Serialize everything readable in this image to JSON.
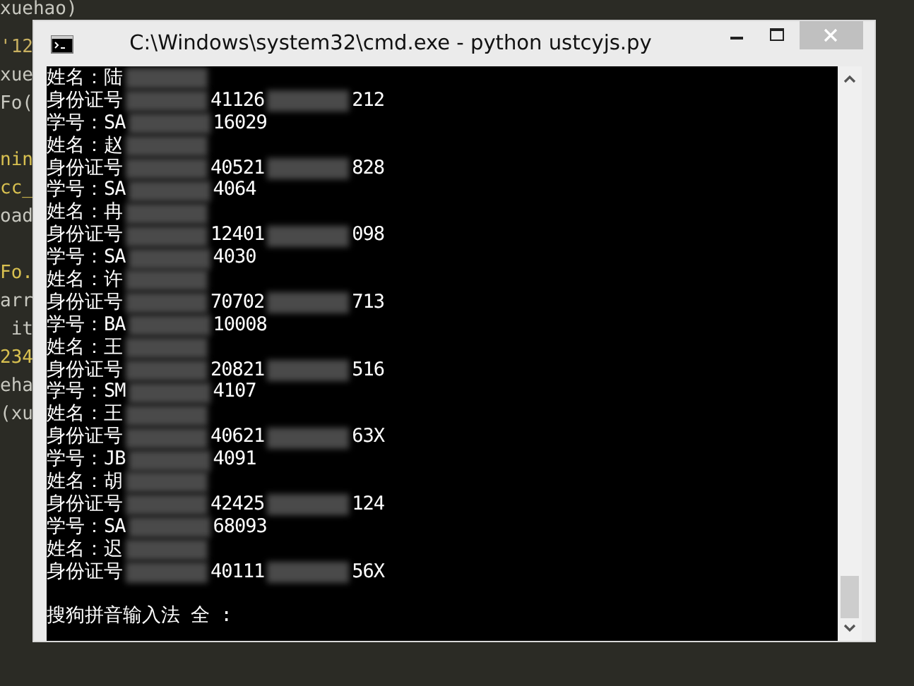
{
  "editor_lines": [
    {
      "text": "xuehao)",
      "color": "#c8c8c0"
    },
    {
      "text": "'12",
      "color": "#c8b060"
    },
    {
      "text": "xue",
      "color": "#c8c8c0"
    },
    {
      "text": "Fo(",
      "color": "#c8c8c0"
    },
    {
      "text": "nin",
      "color": "#d8c050",
      "gap_before": true
    },
    {
      "text": "cc_",
      "color": "#d8c050"
    },
    {
      "text": "oad",
      "color": "#c8c8c0"
    },
    {
      "text": "Fo.",
      "color": "#d8c050",
      "gap_before": true
    },
    {
      "text": "arr",
      "color": "#c8c8c0"
    },
    {
      "text": " it",
      "color": "#c8c8c0"
    },
    {
      "text": "234",
      "color": "#d8c050"
    },
    {
      "text": "eha",
      "color": "#c8c8c0"
    },
    {
      "text": "(xu",
      "color": "#c8c8c0"
    }
  ],
  "window": {
    "title": "C:\\Windows\\system32\\cmd.exe - python  ustcyjs.py"
  },
  "console_lines": [
    {
      "parts": [
        {
          "kind": "text",
          "text": "姓名：陆"
        },
        {
          "kind": "redacted"
        }
      ]
    },
    {
      "parts": [
        {
          "kind": "text",
          "text": "身份证号"
        },
        {
          "kind": "redacted"
        },
        {
          "kind": "text",
          "text": "41126"
        },
        {
          "kind": "redacted"
        },
        {
          "kind": "text",
          "text": "212"
        }
      ]
    },
    {
      "parts": [
        {
          "kind": "text",
          "text": "学号：SA"
        },
        {
          "kind": "redacted"
        },
        {
          "kind": "text",
          "text": "16029"
        }
      ]
    },
    {
      "parts": [
        {
          "kind": "text",
          "text": "姓名：赵"
        },
        {
          "kind": "redacted"
        }
      ]
    },
    {
      "parts": [
        {
          "kind": "text",
          "text": "身份证号"
        },
        {
          "kind": "redacted"
        },
        {
          "kind": "text",
          "text": "40521"
        },
        {
          "kind": "redacted"
        },
        {
          "kind": "text",
          "text": "828"
        }
      ]
    },
    {
      "parts": [
        {
          "kind": "text",
          "text": "学号：SA"
        },
        {
          "kind": "redacted"
        },
        {
          "kind": "text",
          "text": "4064"
        }
      ]
    },
    {
      "parts": [
        {
          "kind": "text",
          "text": "姓名：冉"
        },
        {
          "kind": "redacted"
        }
      ]
    },
    {
      "parts": [
        {
          "kind": "text",
          "text": "身份证号"
        },
        {
          "kind": "redacted"
        },
        {
          "kind": "text",
          "text": "12401"
        },
        {
          "kind": "redacted"
        },
        {
          "kind": "text",
          "text": "098"
        }
      ]
    },
    {
      "parts": [
        {
          "kind": "text",
          "text": "学号：SA"
        },
        {
          "kind": "redacted"
        },
        {
          "kind": "text",
          "text": "4030"
        }
      ]
    },
    {
      "parts": [
        {
          "kind": "text",
          "text": "姓名：许"
        },
        {
          "kind": "redacted"
        }
      ]
    },
    {
      "parts": [
        {
          "kind": "text",
          "text": "身份证号"
        },
        {
          "kind": "redacted"
        },
        {
          "kind": "text",
          "text": "70702"
        },
        {
          "kind": "redacted"
        },
        {
          "kind": "text",
          "text": "713"
        }
      ]
    },
    {
      "parts": [
        {
          "kind": "text",
          "text": "学号：BA"
        },
        {
          "kind": "redacted"
        },
        {
          "kind": "text",
          "text": "10008"
        }
      ]
    },
    {
      "parts": [
        {
          "kind": "text",
          "text": "姓名：王"
        },
        {
          "kind": "redacted"
        }
      ]
    },
    {
      "parts": [
        {
          "kind": "text",
          "text": "身份证号"
        },
        {
          "kind": "redacted"
        },
        {
          "kind": "text",
          "text": "20821"
        },
        {
          "kind": "redacted"
        },
        {
          "kind": "text",
          "text": "516"
        }
      ]
    },
    {
      "parts": [
        {
          "kind": "text",
          "text": "学号：SM"
        },
        {
          "kind": "redacted"
        },
        {
          "kind": "text",
          "text": "4107"
        }
      ]
    },
    {
      "parts": [
        {
          "kind": "text",
          "text": "姓名：王"
        },
        {
          "kind": "redacted"
        }
      ]
    },
    {
      "parts": [
        {
          "kind": "text",
          "text": "身份证号"
        },
        {
          "kind": "redacted"
        },
        {
          "kind": "text",
          "text": "40621"
        },
        {
          "kind": "redacted"
        },
        {
          "kind": "text",
          "text": "63X"
        }
      ]
    },
    {
      "parts": [
        {
          "kind": "text",
          "text": "学号：JB"
        },
        {
          "kind": "redacted"
        },
        {
          "kind": "text",
          "text": "4091"
        }
      ]
    },
    {
      "parts": [
        {
          "kind": "text",
          "text": "姓名：胡"
        },
        {
          "kind": "redacted"
        }
      ]
    },
    {
      "parts": [
        {
          "kind": "text",
          "text": "身份证号"
        },
        {
          "kind": "redacted"
        },
        {
          "kind": "text",
          "text": "42425"
        },
        {
          "kind": "redacted"
        },
        {
          "kind": "text",
          "text": "124"
        }
      ]
    },
    {
      "parts": [
        {
          "kind": "text",
          "text": "学号：SA"
        },
        {
          "kind": "redacted"
        },
        {
          "kind": "text",
          "text": "68093"
        }
      ]
    },
    {
      "parts": [
        {
          "kind": "text",
          "text": "姓名：迟"
        },
        {
          "kind": "redacted"
        }
      ]
    },
    {
      "parts": [
        {
          "kind": "text",
          "text": "身份证号"
        },
        {
          "kind": "redacted"
        },
        {
          "kind": "text",
          "text": "40111"
        },
        {
          "kind": "redacted"
        },
        {
          "kind": "text",
          "text": "56X"
        }
      ]
    },
    {
      "gap_before": true,
      "parts": [
        {
          "kind": "text",
          "text": "搜狗拼音输入法 全 :"
        }
      ]
    }
  ]
}
